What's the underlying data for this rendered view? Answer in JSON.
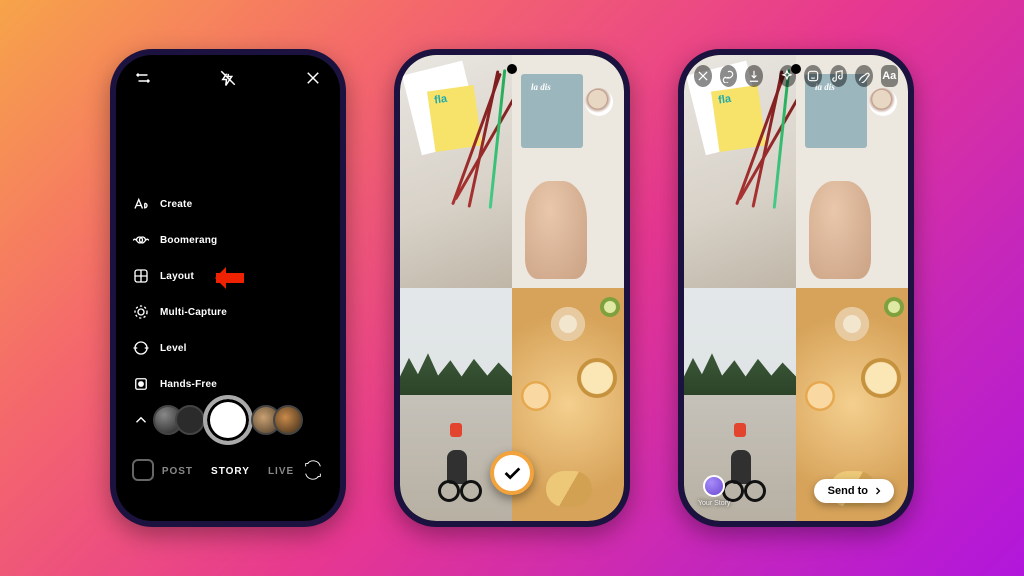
{
  "phone1": {
    "modes": {
      "create": "Create",
      "boomerang": "Boomerang",
      "layout": "Layout",
      "multi_capture": "Multi-Capture",
      "level": "Level",
      "hands_free": "Hands-Free",
      "close": "Close"
    },
    "tabs": {
      "post": "POST",
      "story": "STORY",
      "live": "LIVE"
    },
    "highlighted_mode": "layout"
  },
  "phone3": {
    "your_story_label": "Your Story",
    "send_to_label": "Send to"
  }
}
